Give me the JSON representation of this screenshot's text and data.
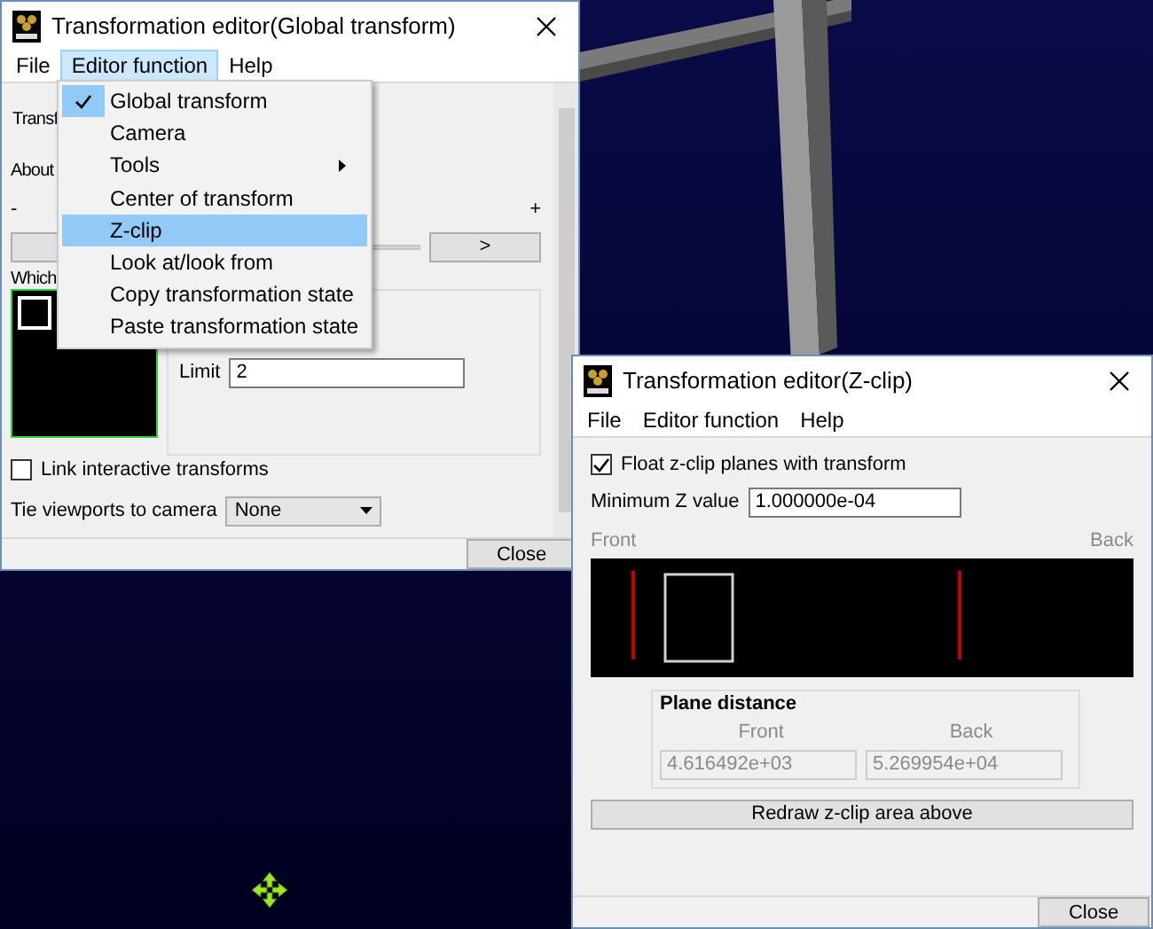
{
  "global_window": {
    "title": "Transformation editor(Global transform)",
    "menu": [
      {
        "label": "File",
        "selected": false
      },
      {
        "label": "Editor function",
        "selected": true
      },
      {
        "label": "Help",
        "selected": false
      }
    ],
    "transform_label": "Transf",
    "about_label": "About",
    "minus": "-",
    "plus": "+",
    "next_button": ">",
    "which_label": "Which",
    "limit": {
      "label": "Limit",
      "value": "2"
    },
    "link": {
      "label": "Link interactive transforms",
      "checked": false
    },
    "tie": {
      "label": "Tie viewports to camera",
      "value": "None"
    },
    "close": "Close"
  },
  "menu_popup": [
    {
      "label": "Global transform",
      "checked": true,
      "selected": false,
      "submenu": false
    },
    {
      "label": "Camera",
      "checked": false,
      "selected": false,
      "submenu": false
    },
    {
      "label": "Tools",
      "checked": false,
      "selected": false,
      "submenu": true
    },
    {
      "label": "Center of transform",
      "checked": false,
      "selected": false,
      "submenu": false
    },
    {
      "label": "Z-clip",
      "checked": false,
      "selected": true,
      "submenu": false
    },
    {
      "label": "Look at/look from",
      "checked": false,
      "selected": false,
      "submenu": false
    },
    {
      "label": "Copy transformation state",
      "checked": false,
      "selected": false,
      "submenu": false
    },
    {
      "label": "Paste transformation state",
      "checked": false,
      "selected": false,
      "submenu": false
    }
  ],
  "zclip_window": {
    "title": "Transformation editor(Z-clip)",
    "menu": [
      {
        "label": "File",
        "selected": false
      },
      {
        "label": "Editor function",
        "selected": false
      },
      {
        "label": "Help",
        "selected": false
      }
    ],
    "float": {
      "label": "Float z-clip planes with transform",
      "checked": true
    },
    "min_z": {
      "label": "Minimum Z value",
      "value": "1.000000e-04"
    },
    "front_label": "Front",
    "back_label": "Back",
    "plane": {
      "title": "Plane distance",
      "front_label": "Front",
      "back_label": "Back",
      "front_value": "4.616492e+03",
      "back_value": "5.269954e+04"
    },
    "redraw": "Redraw z-clip area above",
    "close": "Close"
  }
}
